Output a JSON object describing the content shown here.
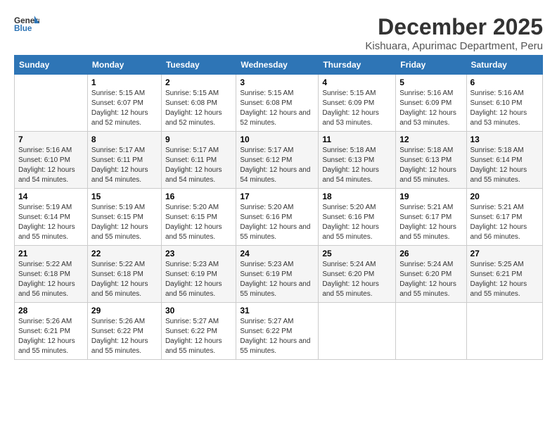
{
  "logo": {
    "line1": "General",
    "line2": "Blue"
  },
  "title": "December 2025",
  "subtitle": "Kishuara, Apurimac Department, Peru",
  "days_of_week": [
    "Sunday",
    "Monday",
    "Tuesday",
    "Wednesday",
    "Thursday",
    "Friday",
    "Saturday"
  ],
  "weeks": [
    [
      {
        "day": "",
        "sunrise": "",
        "sunset": "",
        "daylight": ""
      },
      {
        "day": "1",
        "sunrise": "5:15 AM",
        "sunset": "6:07 PM",
        "daylight": "12 hours and 52 minutes."
      },
      {
        "day": "2",
        "sunrise": "5:15 AM",
        "sunset": "6:08 PM",
        "daylight": "12 hours and 52 minutes."
      },
      {
        "day": "3",
        "sunrise": "5:15 AM",
        "sunset": "6:08 PM",
        "daylight": "12 hours and 52 minutes."
      },
      {
        "day": "4",
        "sunrise": "5:15 AM",
        "sunset": "6:09 PM",
        "daylight": "12 hours and 53 minutes."
      },
      {
        "day": "5",
        "sunrise": "5:16 AM",
        "sunset": "6:09 PM",
        "daylight": "12 hours and 53 minutes."
      },
      {
        "day": "6",
        "sunrise": "5:16 AM",
        "sunset": "6:10 PM",
        "daylight": "12 hours and 53 minutes."
      }
    ],
    [
      {
        "day": "7",
        "sunrise": "5:16 AM",
        "sunset": "6:10 PM",
        "daylight": "12 hours and 54 minutes."
      },
      {
        "day": "8",
        "sunrise": "5:17 AM",
        "sunset": "6:11 PM",
        "daylight": "12 hours and 54 minutes."
      },
      {
        "day": "9",
        "sunrise": "5:17 AM",
        "sunset": "6:11 PM",
        "daylight": "12 hours and 54 minutes."
      },
      {
        "day": "10",
        "sunrise": "5:17 AM",
        "sunset": "6:12 PM",
        "daylight": "12 hours and 54 minutes."
      },
      {
        "day": "11",
        "sunrise": "5:18 AM",
        "sunset": "6:13 PM",
        "daylight": "12 hours and 54 minutes."
      },
      {
        "day": "12",
        "sunrise": "5:18 AM",
        "sunset": "6:13 PM",
        "daylight": "12 hours and 55 minutes."
      },
      {
        "day": "13",
        "sunrise": "5:18 AM",
        "sunset": "6:14 PM",
        "daylight": "12 hours and 55 minutes."
      }
    ],
    [
      {
        "day": "14",
        "sunrise": "5:19 AM",
        "sunset": "6:14 PM",
        "daylight": "12 hours and 55 minutes."
      },
      {
        "day": "15",
        "sunrise": "5:19 AM",
        "sunset": "6:15 PM",
        "daylight": "12 hours and 55 minutes."
      },
      {
        "day": "16",
        "sunrise": "5:20 AM",
        "sunset": "6:15 PM",
        "daylight": "12 hours and 55 minutes."
      },
      {
        "day": "17",
        "sunrise": "5:20 AM",
        "sunset": "6:16 PM",
        "daylight": "12 hours and 55 minutes."
      },
      {
        "day": "18",
        "sunrise": "5:20 AM",
        "sunset": "6:16 PM",
        "daylight": "12 hours and 55 minutes."
      },
      {
        "day": "19",
        "sunrise": "5:21 AM",
        "sunset": "6:17 PM",
        "daylight": "12 hours and 55 minutes."
      },
      {
        "day": "20",
        "sunrise": "5:21 AM",
        "sunset": "6:17 PM",
        "daylight": "12 hours and 56 minutes."
      }
    ],
    [
      {
        "day": "21",
        "sunrise": "5:22 AM",
        "sunset": "6:18 PM",
        "daylight": "12 hours and 56 minutes."
      },
      {
        "day": "22",
        "sunrise": "5:22 AM",
        "sunset": "6:18 PM",
        "daylight": "12 hours and 56 minutes."
      },
      {
        "day": "23",
        "sunrise": "5:23 AM",
        "sunset": "6:19 PM",
        "daylight": "12 hours and 56 minutes."
      },
      {
        "day": "24",
        "sunrise": "5:23 AM",
        "sunset": "6:19 PM",
        "daylight": "12 hours and 55 minutes."
      },
      {
        "day": "25",
        "sunrise": "5:24 AM",
        "sunset": "6:20 PM",
        "daylight": "12 hours and 55 minutes."
      },
      {
        "day": "26",
        "sunrise": "5:24 AM",
        "sunset": "6:20 PM",
        "daylight": "12 hours and 55 minutes."
      },
      {
        "day": "27",
        "sunrise": "5:25 AM",
        "sunset": "6:21 PM",
        "daylight": "12 hours and 55 minutes."
      }
    ],
    [
      {
        "day": "28",
        "sunrise": "5:26 AM",
        "sunset": "6:21 PM",
        "daylight": "12 hours and 55 minutes."
      },
      {
        "day": "29",
        "sunrise": "5:26 AM",
        "sunset": "6:22 PM",
        "daylight": "12 hours and 55 minutes."
      },
      {
        "day": "30",
        "sunrise": "5:27 AM",
        "sunset": "6:22 PM",
        "daylight": "12 hours and 55 minutes."
      },
      {
        "day": "31",
        "sunrise": "5:27 AM",
        "sunset": "6:22 PM",
        "daylight": "12 hours and 55 minutes."
      },
      {
        "day": "",
        "sunrise": "",
        "sunset": "",
        "daylight": ""
      },
      {
        "day": "",
        "sunrise": "",
        "sunset": "",
        "daylight": ""
      },
      {
        "day": "",
        "sunrise": "",
        "sunset": "",
        "daylight": ""
      }
    ]
  ],
  "labels": {
    "sunrise_prefix": "Sunrise: ",
    "sunset_prefix": "Sunset: ",
    "daylight_prefix": "Daylight: "
  }
}
